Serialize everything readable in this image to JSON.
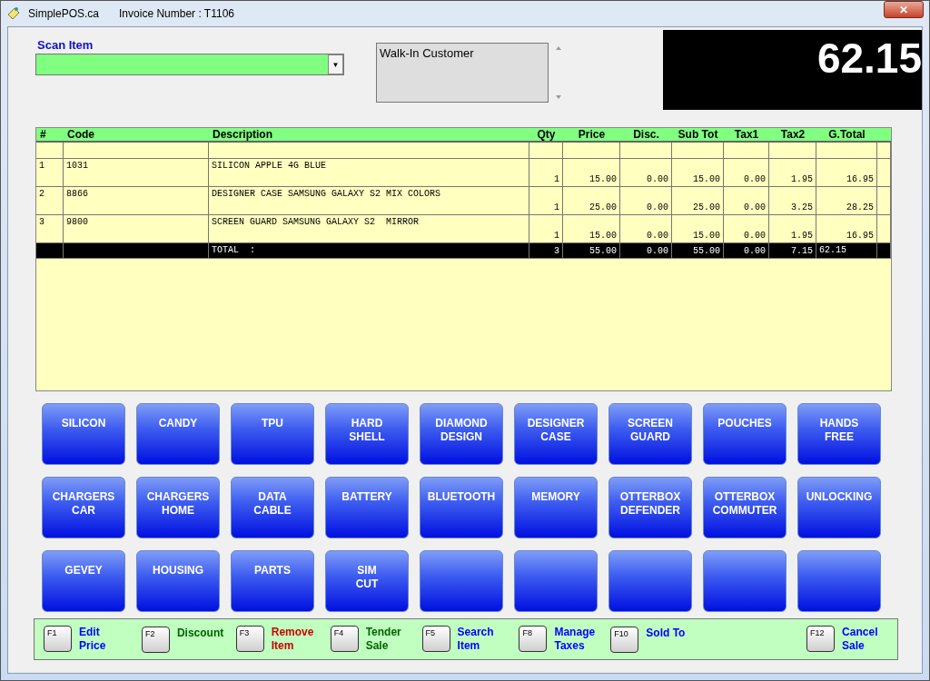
{
  "window": {
    "title": "SimplePOS.ca",
    "invoice": "Invoice Number : T1106",
    "close": "✕"
  },
  "scan": {
    "label": "Scan Item",
    "arrow": "▼"
  },
  "customer": {
    "value": "Walk-In Customer"
  },
  "display": {
    "total": "62.15"
  },
  "table": {
    "columns": [
      "#",
      "Code",
      "Description",
      "Qty",
      "Price",
      "Disc.",
      "Sub Tot",
      "Tax1",
      "Tax2",
      "G.Total"
    ],
    "rows": [
      {
        "kind": "item",
        "cells": [
          "1",
          "1031",
          "SILICON APPLE 4G BLUE",
          "1",
          "15.00",
          "0.00",
          "15.00",
          "0.00",
          "1.95",
          "16.95"
        ]
      },
      {
        "kind": "item",
        "cells": [
          "2",
          "8866",
          "DESIGNER CASE SAMSUNG GALAXY S2 MIX COLORS",
          "1",
          "25.00",
          "0.00",
          "25.00",
          "0.00",
          "3.25",
          "28.25"
        ]
      },
      {
        "kind": "item",
        "cells": [
          "3",
          "9800",
          "SCREEN GUARD SAMSUNG GALAXY S2  MIRROR",
          "1",
          "15.00",
          "0.00",
          "15.00",
          "0.00",
          "1.95",
          "16.95"
        ]
      },
      {
        "kind": "total",
        "cells": [
          "",
          "",
          "TOTAL  :",
          "3",
          "55.00",
          "0.00",
          "55.00",
          "0.00",
          "7.15",
          "62.15"
        ]
      }
    ]
  },
  "categories": [
    {
      "kind": "category",
      "label": "SILICON"
    },
    {
      "kind": "category",
      "label": "CANDY"
    },
    {
      "kind": "category",
      "label": "TPU"
    },
    {
      "kind": "category",
      "label": "HARD\nSHELL"
    },
    {
      "kind": "category",
      "label": "DIAMOND\nDESIGN"
    },
    {
      "kind": "category",
      "label": "DESIGNER\nCASE"
    },
    {
      "kind": "category",
      "label": "SCREEN\nGUARD"
    },
    {
      "kind": "category",
      "label": "POUCHES"
    },
    {
      "kind": "category",
      "label": "HANDS\nFREE"
    },
    {
      "kind": "category",
      "label": "CHARGERS\nCAR"
    },
    {
      "kind": "category",
      "label": "CHARGERS\nHOME"
    },
    {
      "kind": "category",
      "label": "DATA\nCABLE"
    },
    {
      "kind": "category",
      "label": "BATTERY"
    },
    {
      "kind": "category",
      "label": "BLUETOOTH"
    },
    {
      "kind": "category",
      "label": "MEMORY"
    },
    {
      "kind": "category",
      "label": "OTTERBOX\nDEFENDER"
    },
    {
      "kind": "category",
      "label": "OTTERBOX\nCOMMUTER"
    },
    {
      "kind": "category",
      "label": "UNLOCKING"
    },
    {
      "kind": "category",
      "label": "GEVEY"
    },
    {
      "kind": "category",
      "label": "HOUSING"
    },
    {
      "kind": "category",
      "label": "PARTS"
    },
    {
      "kind": "category",
      "label": "SIM\nCUT"
    },
    {
      "kind": "blank"
    },
    {
      "kind": "blank"
    },
    {
      "kind": "blank"
    },
    {
      "kind": "blank"
    },
    {
      "kind": "blank"
    }
  ],
  "function_keys": [
    {
      "key": "F1",
      "label": "Edit\nPrice",
      "color": "#0000ff"
    },
    {
      "key": "F2",
      "label": "Discount",
      "color": "#006400"
    },
    {
      "key": "F3",
      "label": "Remove\nItem",
      "color": "#cc0000"
    },
    {
      "key": "F4",
      "label": "Tender\nSale",
      "color": "#006400"
    },
    {
      "key": "F5",
      "label": "Search\nItem",
      "color": "#0000ff"
    },
    {
      "key": "F8",
      "label": "Manage\nTaxes",
      "color": "#0000ff"
    },
    {
      "key": "F10",
      "label": "Sold To",
      "color": "#0000ff"
    },
    {
      "key": "F12",
      "label": "Cancel\nSale",
      "color": "#0000ff"
    }
  ]
}
